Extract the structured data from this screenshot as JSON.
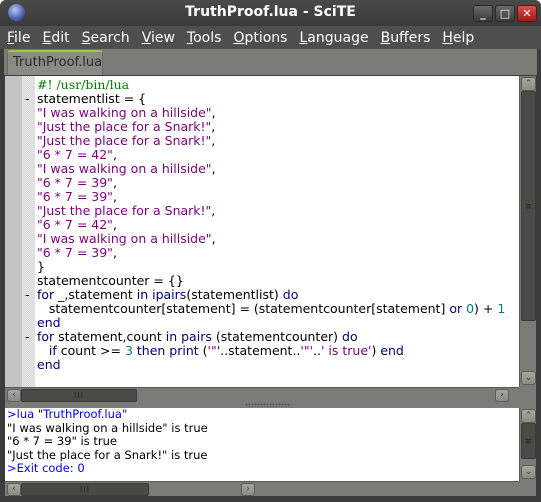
{
  "window": {
    "title": "TruthProof.lua - SciTE",
    "app_icon": "scite-globe-icon",
    "controls": {
      "minimize": "_",
      "maximize": "□",
      "close": "✕"
    }
  },
  "menubar": {
    "items": [
      {
        "label": "File",
        "mnemonic": "F",
        "rest": "ile"
      },
      {
        "label": "Edit",
        "mnemonic": "E",
        "rest": "dit"
      },
      {
        "label": "Search",
        "mnemonic": "S",
        "rest": "earch"
      },
      {
        "label": "View",
        "mnemonic": "V",
        "rest": "iew"
      },
      {
        "label": "Tools",
        "mnemonic": "T",
        "rest": "ools"
      },
      {
        "label": "Options",
        "mnemonic": "O",
        "rest": "ptions"
      },
      {
        "label": "Language",
        "mnemonic": "L",
        "rest": "anguage"
      },
      {
        "label": "Buffers",
        "mnemonic": "B",
        "rest": "uffers"
      },
      {
        "label": "Help",
        "mnemonic": "H",
        "rest": "elp"
      }
    ]
  },
  "tabs": [
    {
      "label": "TruthProof.lua",
      "active": true
    }
  ],
  "editor": {
    "lines": [
      {
        "fold": "",
        "indent": "",
        "tokens": [
          {
            "t": "#! /usr/bin/lua",
            "c": "comment"
          }
        ]
      },
      {
        "fold": "-",
        "indent": "",
        "tokens": [
          {
            "t": "statementlist = {",
            "c": "def"
          }
        ]
      },
      {
        "fold": "",
        "indent": "",
        "tokens": [
          {
            "t": "\"I was walking on a hillside\"",
            "c": "str"
          },
          {
            "t": ",",
            "c": "def"
          }
        ]
      },
      {
        "fold": "",
        "indent": "",
        "tokens": [
          {
            "t": "\"Just the place for a Snark!\"",
            "c": "str"
          },
          {
            "t": ",",
            "c": "def"
          }
        ]
      },
      {
        "fold": "",
        "indent": "",
        "tokens": [
          {
            "t": "\"Just the place for a Snark!\"",
            "c": "str"
          },
          {
            "t": ",",
            "c": "def"
          }
        ]
      },
      {
        "fold": "",
        "indent": "",
        "tokens": [
          {
            "t": "\"6 * 7 = 42\"",
            "c": "str"
          },
          {
            "t": ",",
            "c": "def"
          }
        ]
      },
      {
        "fold": "",
        "indent": "",
        "tokens": [
          {
            "t": "\"I was walking on a hillside\"",
            "c": "str"
          },
          {
            "t": ",",
            "c": "def"
          }
        ]
      },
      {
        "fold": "",
        "indent": "",
        "tokens": [
          {
            "t": "\"6 * 7 = 39\"",
            "c": "str"
          },
          {
            "t": ",",
            "c": "def"
          }
        ]
      },
      {
        "fold": "",
        "indent": "",
        "tokens": [
          {
            "t": "\"6 * 7 = 39\"",
            "c": "str"
          },
          {
            "t": ",",
            "c": "def"
          }
        ]
      },
      {
        "fold": "",
        "indent": "",
        "tokens": [
          {
            "t": "\"Just the place for a Snark!\"",
            "c": "str"
          },
          {
            "t": ",",
            "c": "def"
          }
        ]
      },
      {
        "fold": "",
        "indent": "",
        "tokens": [
          {
            "t": "\"6 * 7 = 42\"",
            "c": "str"
          },
          {
            "t": ",",
            "c": "def"
          }
        ]
      },
      {
        "fold": "",
        "indent": "",
        "tokens": [
          {
            "t": "\"I was walking on a hillside\"",
            "c": "str"
          },
          {
            "t": ",",
            "c": "def"
          }
        ]
      },
      {
        "fold": "",
        "indent": "",
        "tokens": [
          {
            "t": "\"6 * 7 = 39\"",
            "c": "str"
          },
          {
            "t": ",",
            "c": "def"
          }
        ]
      },
      {
        "fold": "",
        "indent": "",
        "tokens": [
          {
            "t": "}",
            "c": "def"
          }
        ]
      },
      {
        "fold": "",
        "indent": "",
        "tokens": [
          {
            "t": "statementcounter = {}",
            "c": "def"
          }
        ]
      },
      {
        "fold": "-",
        "indent": "",
        "tokens": [
          {
            "t": "for",
            "c": "kw"
          },
          {
            "t": " _,statement ",
            "c": "def"
          },
          {
            "t": "in",
            "c": "kw"
          },
          {
            "t": " ",
            "c": "def"
          },
          {
            "t": "ipairs",
            "c": "kw"
          },
          {
            "t": "(statementlist) ",
            "c": "def"
          },
          {
            "t": "do",
            "c": "kw"
          }
        ]
      },
      {
        "fold": "",
        "indent": "   ",
        "tokens": [
          {
            "t": "statementcounter[statement] = (statementcounter[statement] ",
            "c": "def"
          },
          {
            "t": "or",
            "c": "kw"
          },
          {
            "t": " ",
            "c": "def"
          },
          {
            "t": "0",
            "c": "num"
          },
          {
            "t": ") + ",
            "c": "def"
          },
          {
            "t": "1",
            "c": "num"
          }
        ]
      },
      {
        "fold": "",
        "indent": "",
        "tokens": [
          {
            "t": "end",
            "c": "kw"
          }
        ]
      },
      {
        "fold": "-",
        "indent": "",
        "tokens": [
          {
            "t": "for",
            "c": "kw"
          },
          {
            "t": " statement,count ",
            "c": "def"
          },
          {
            "t": "in",
            "c": "kw"
          },
          {
            "t": " ",
            "c": "def"
          },
          {
            "t": "pairs",
            "c": "kw"
          },
          {
            "t": " (statementcounter) ",
            "c": "def"
          },
          {
            "t": "do",
            "c": "kw"
          }
        ]
      },
      {
        "fold": "",
        "indent": "   ",
        "tokens": [
          {
            "t": "if",
            "c": "kw"
          },
          {
            "t": " count >= ",
            "c": "def"
          },
          {
            "t": "3",
            "c": "num"
          },
          {
            "t": " ",
            "c": "def"
          },
          {
            "t": "then",
            "c": "kw"
          },
          {
            "t": " ",
            "c": "def"
          },
          {
            "t": "print",
            "c": "kw"
          },
          {
            "t": " (",
            "c": "def"
          },
          {
            "t": "'\"'",
            "c": "str"
          },
          {
            "t": "..statement..",
            "c": "def"
          },
          {
            "t": "'\"'",
            "c": "str"
          },
          {
            "t": "..",
            "c": "def"
          },
          {
            "t": "' is true'",
            "c": "str"
          },
          {
            "t": ") ",
            "c": "def"
          },
          {
            "t": "end",
            "c": "kw"
          }
        ]
      },
      {
        "fold": "",
        "indent": "",
        "tokens": [
          {
            "t": "end",
            "c": "kw"
          }
        ]
      }
    ]
  },
  "output": {
    "lines": [
      {
        "text": ">lua \"TruthProof.lua\"",
        "kind": "cmd"
      },
      {
        "text": "\"I was walking on a hillside\" is true",
        "kind": "std"
      },
      {
        "text": "\"6 * 7 = 39\" is true",
        "kind": "std"
      },
      {
        "text": "\"Just the place for a Snark!\" is true",
        "kind": "std"
      },
      {
        "text": ">Exit code: 0",
        "kind": "cmd"
      }
    ]
  },
  "scrollbars": {
    "up_arrow": "⌃",
    "down_arrow": "⌄",
    "left_arrow": "‹",
    "right_arrow": "›",
    "grip_v": "≡",
    "grip_h": "III"
  }
}
